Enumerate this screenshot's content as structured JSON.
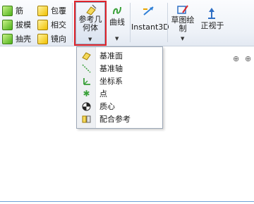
{
  "ribbon": {
    "col1": [
      "筋",
      "拔模",
      "抽壳"
    ],
    "col2": [
      "包覆",
      "相交",
      "镜向"
    ],
    "ref_geometry_label": [
      "参考几",
      "何体"
    ],
    "curves_label": "曲线",
    "instant3d_label": "Instant3D",
    "sketch_label": [
      "草图绘",
      "制"
    ],
    "normal_to_label": "正视于"
  },
  "menu": {
    "items": [
      "基准面",
      "基准轴",
      "坐标系",
      "点",
      "质心",
      "配合参考"
    ]
  },
  "colors": {
    "highlight": "#e0232a",
    "accent": "#4fb21b"
  }
}
